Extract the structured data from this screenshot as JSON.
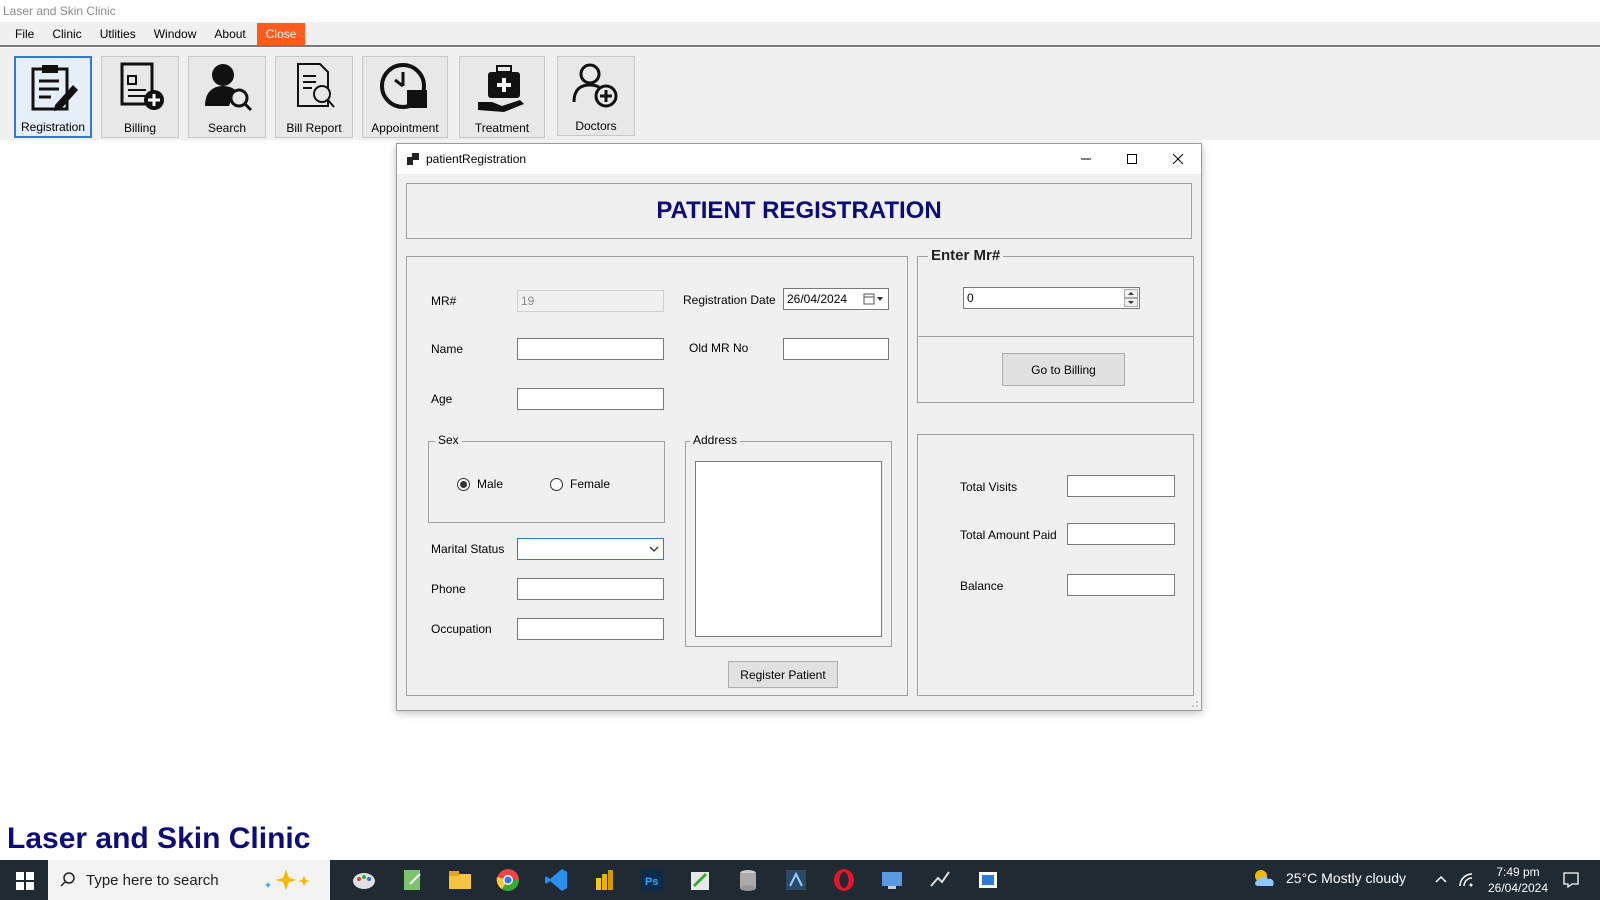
{
  "window": {
    "title": "Laser and Skin Clinic"
  },
  "menu": {
    "items": [
      "File",
      "Clinic",
      "Utlities",
      "Window",
      "About",
      "Close"
    ]
  },
  "toolbar": {
    "buttons": [
      {
        "label": "Registration",
        "icon": "registration-icon"
      },
      {
        "label": "Billing",
        "icon": "billing-icon"
      },
      {
        "label": "Search",
        "icon": "search-user-icon"
      },
      {
        "label": "Bill Report",
        "icon": "bill-report-icon"
      },
      {
        "label": "Appointment",
        "icon": "clock-icon"
      },
      {
        "label": "Treatment",
        "icon": "medical-kit-icon"
      },
      {
        "label": "Doctors",
        "icon": "add-user-icon"
      }
    ]
  },
  "form": {
    "title": "patientRegistration",
    "heading": "PATIENT REGISTRATION",
    "mr_label": "MR#",
    "mr_value": "19",
    "reg_date_label": "Registration Date",
    "reg_date_value": "26/04/2024",
    "name_label": "Name",
    "old_mr_label": "Old MR No",
    "age_label": "Age",
    "sex_label": "Sex",
    "sex_options": [
      "Male",
      "Female"
    ],
    "sex_selected": "Male",
    "address_label": "Address",
    "marital_label": "Marital Status",
    "phone_label": "Phone",
    "occupation_label": "Occupation",
    "register_button": "Register Patient",
    "enter_mr_label": "Enter Mr#",
    "enter_mr_value": "0",
    "billing_button": "Go to Billing",
    "total_visits_label": "Total Visits",
    "total_paid_label": "Total Amount Paid",
    "balance_label": "Balance"
  },
  "footer": {
    "title": "Laser and Skin Clinic"
  },
  "taskbar": {
    "search_placeholder": "Type here to search",
    "weather": "25°C  Mostly cloudy",
    "time": "7:49 pm",
    "date": "26/04/2024"
  },
  "colors": {
    "heading": "#0b0b7a",
    "close_menu": "#ff5b1f",
    "taskbar": "#1f2a33"
  }
}
